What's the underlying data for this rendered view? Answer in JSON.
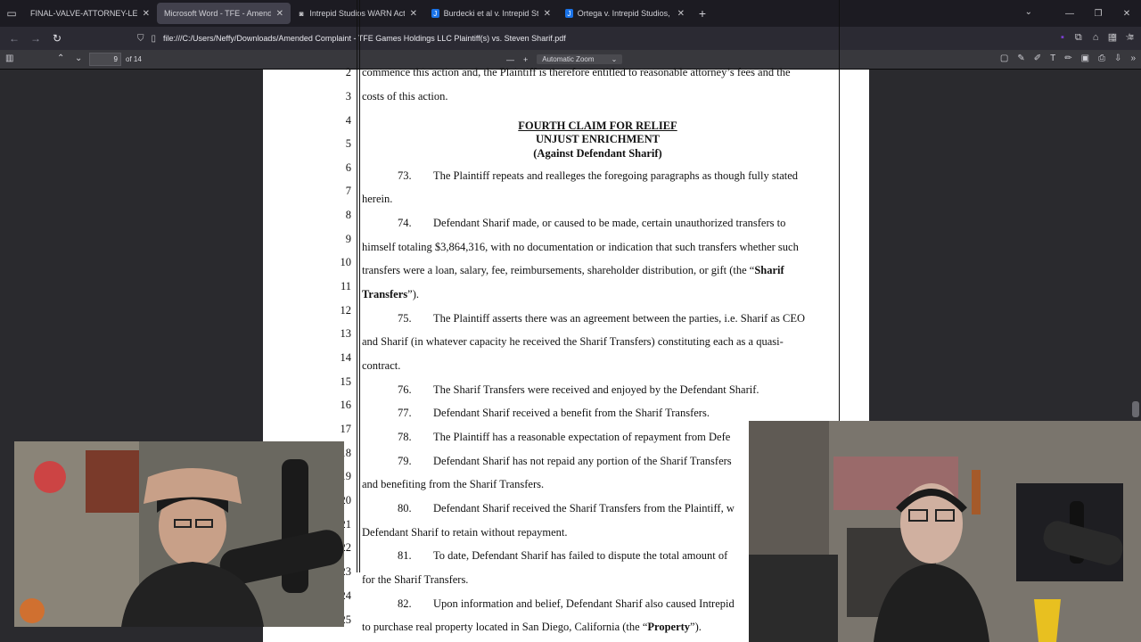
{
  "tabs": [
    {
      "label": "FINAL-VALVE-ATTORNEY-LETTER.p",
      "icon": "pdf-icon",
      "active": false
    },
    {
      "label": "Microsoft Word - TFE - Amended C",
      "icon": "pdf-icon",
      "active": true
    },
    {
      "label": "Intrepid Studios WARN Act Inve",
      "icon": "doc-icon",
      "active": false
    },
    {
      "label": "Burdecki et al v. Intrepid Studio",
      "icon": "justia-icon",
      "active": false
    },
    {
      "label": "Ortega v. Intrepid Studios, Inc.",
      "icon": "justia-icon",
      "active": false
    }
  ],
  "url": "file:///C:/Users/Neffy/Downloads/Amended Complaint - TFE Games Holdings LLC Plaintiff(s) vs. Steven Sharif.pdf",
  "pdf_toolbar": {
    "page_number": "9",
    "page_count": "of 14",
    "zoom_label": "Automatic Zoom"
  },
  "document": {
    "line_numbers": [
      "2",
      "3",
      "4",
      "5",
      "6",
      "7",
      "8",
      "9",
      "10",
      "11",
      "12",
      "13",
      "14",
      "15",
      "16",
      "17",
      "18",
      "19",
      "20",
      "21",
      "22",
      "23",
      "24",
      "25"
    ],
    "lines": {
      "l2": "commence this action and, the Plaintiff is therefore entitled to reasonable attorney’s fees and the",
      "l3": "costs of this action.",
      "heading1": "FOURTH CLAIM FOR RELIEF",
      "heading2": "UNJUST ENRICHMENT",
      "heading3": "(Against Defendant Sharif)",
      "p73_num": "73.",
      "p73_a": "The Plaintiff repeats and realleges the foregoing paragraphs as though fully stated",
      "p73_b": "herein.",
      "p74_num": "74.",
      "p74_a": "Defendant Sharif made, or caused to be made, certain unauthorized transfers to",
      "p74_b": "himself totaling $3,864,316, with no documentation or indication that such transfers whether such",
      "p74_c": "transfers were a loan, salary, fee, reimbursements, shareholder distribution, or gift (the “",
      "p74_c_bold": "Sharif",
      "p74_d_bold": "Transfers",
      "p74_d": "”).",
      "p75_num": "75.",
      "p75_a": "The Plaintiff asserts there was an agreement between the parties, i.e. Sharif as CEO",
      "p75_b": "and Sharif (in whatever capacity he received the Sharif Transfers) constituting each as a quasi-",
      "p75_c": "contract.",
      "p76_num": "76.",
      "p76": "The Sharif Transfers were received and enjoyed by the Defendant Sharif.",
      "p77_num": "77.",
      "p77": "Defendant Sharif received a benefit from the Sharif Transfers.",
      "p78_num": "78.",
      "p78": "The Plaintiff has a reasonable expectation of repayment from Defe",
      "p79_num": "79.",
      "p79_a": "Defendant Sharif has not repaid any portion of the Sharif Transfers",
      "p79_b": "and benefiting from the Sharif Transfers.",
      "p80_num": "80.",
      "p80_a": "Defendant Sharif received the Sharif Transfers from the Plaintiff, w",
      "p80_b": "Defendant Sharif to retain without repayment.",
      "p81_num": "81.",
      "p81_a": "To date, Defendant Sharif has failed to dispute the total amount of",
      "p81_b": "for the Sharif Transfers.",
      "p82_num": "82.",
      "p82_a": "Upon information and belief, Defendant Sharif also caused Intrepid",
      "p82_b": "to purchase real property located in San Diego, California (the “",
      "p82_b_bold": "Property",
      "p82_b_end": "”)."
    }
  },
  "colors": {
    "accent": "#0060df",
    "justia_blue": "#1a73e8"
  }
}
